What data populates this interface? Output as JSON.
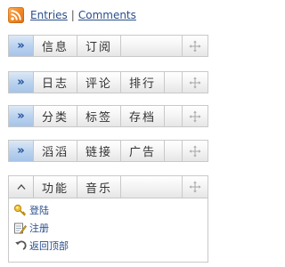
{
  "header": {
    "rss_icon": "rss-feed-icon",
    "entries_label": "Entries",
    "separator": "|",
    "comments_label": "Comments"
  },
  "bars": [
    {
      "toggle": "»",
      "tabs": [
        "信息",
        "订阅"
      ],
      "move_icon": "move-arrows-icon"
    },
    {
      "toggle": "»",
      "tabs": [
        "日志",
        "评论",
        "排行"
      ],
      "move_icon": "move-arrows-icon"
    },
    {
      "toggle": "»",
      "tabs": [
        "分类",
        "标签",
        "存档"
      ],
      "move_icon": "move-arrows-icon"
    },
    {
      "toggle": "»",
      "tabs": [
        "滔滔",
        "链接",
        "广告"
      ],
      "move_icon": "move-arrows-icon"
    },
    {
      "toggle": "^",
      "tabs": [
        "功能",
        "音乐"
      ],
      "move_icon": "move-arrows-icon"
    }
  ],
  "panel": {
    "items": [
      {
        "label": "登陆",
        "icon": "key-icon"
      },
      {
        "label": "注册",
        "icon": "edit-form-icon"
      },
      {
        "label": "返回顶部",
        "icon": "return-arrow-icon"
      }
    ]
  },
  "colors": {
    "link": "#2a4e8a",
    "toggle_active": "#b8d1ee",
    "toggle_text": "#1e4c99",
    "rss": "#f28c28"
  }
}
